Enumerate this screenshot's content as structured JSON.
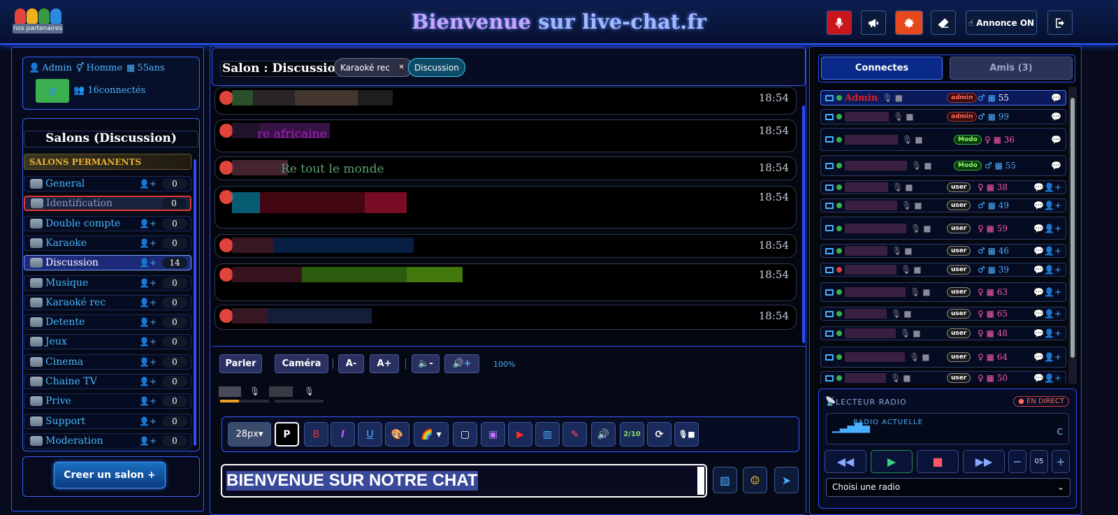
{
  "header": {
    "logo_label": "nos partenaires",
    "title_part1": "Bienvenue",
    "title_part2": " sur live-chat.fr",
    "buttons": [
      {
        "icon": "microphone-icon",
        "color": "#c8161c"
      },
      {
        "icon": "megaphone-icon",
        "color": "#0b1a3a"
      },
      {
        "icon": "gear-icon",
        "color": "#e8491c"
      },
      {
        "icon": "eraser-icon",
        "color": "#0b1a3a"
      },
      {
        "icon": "hand-icon",
        "label": "Annonce ON",
        "color": "#0b1a3a"
      },
      {
        "icon": "logout-icon",
        "color": "#0b1a3a"
      }
    ]
  },
  "user": {
    "name": "Admin",
    "gender": "Homme",
    "age": "55ans",
    "connected": "16connectés"
  },
  "salons": {
    "title": "Salons (Discussion)",
    "permanent_label": "SALONS PERMANENTS",
    "items": [
      {
        "label": "General",
        "count": "0"
      },
      {
        "label": "Identification",
        "count": "0"
      },
      {
        "label": "Double compte",
        "count": "0"
      },
      {
        "label": "Karaoke",
        "count": "0"
      },
      {
        "label": "Discussion",
        "count": "14"
      },
      {
        "label": "Musique",
        "count": "0"
      },
      {
        "label": "Karaoké rec",
        "count": "0"
      },
      {
        "label": "Detente",
        "count": "0"
      },
      {
        "label": "Jeux",
        "count": "0"
      },
      {
        "label": "Cinema",
        "count": "0"
      },
      {
        "label": "Chaine TV",
        "count": "0"
      },
      {
        "label": "Prive",
        "count": "0"
      },
      {
        "label": "Support",
        "count": "0"
      },
      {
        "label": "Moderation",
        "count": "0"
      }
    ],
    "create_button": "Creer un salon +"
  },
  "chat": {
    "salon_title": "Salon : Discussion",
    "tabs": [
      {
        "label": "Karaoké rec",
        "closable": true
      },
      {
        "label": "Discussion",
        "closable": false
      }
    ],
    "messages": [
      {
        "time": "18:54",
        "text": ""
      },
      {
        "time": "18:54",
        "text": "re africaine"
      },
      {
        "time": "18:54",
        "text": "Re tout le monde"
      },
      {
        "time": "18:54",
        "text": ""
      },
      {
        "time": "18:54",
        "text": ""
      },
      {
        "time": "18:54",
        "text": ""
      },
      {
        "time": "18:54",
        "text": ""
      }
    ]
  },
  "controls": {
    "speak": "Parler",
    "camera": "Caméra",
    "font_minus": "A-",
    "font_plus": "A+",
    "volume": "100%",
    "font_size": "28px",
    "bold_p": "P",
    "bold_b": "B",
    "italic": "I",
    "underline": "U",
    "counter": "2/10",
    "input_value": "BIENVENUE SUR NOTRE CHAT"
  },
  "right": {
    "tab_connected": "Connectes",
    "tab_friends": "Amis (3)",
    "users": [
      {
        "name": "Admin",
        "role": "admin",
        "gender": "m",
        "age": "55"
      },
      {
        "name": "",
        "role": "admin",
        "gender": "m",
        "age": "99"
      },
      {
        "name": "",
        "role": "Modo",
        "gender": "f",
        "age": "36"
      },
      {
        "name": "",
        "role": "Modo",
        "gender": "m",
        "age": "55"
      },
      {
        "name": "",
        "role": "user",
        "gender": "f",
        "age": "38"
      },
      {
        "name": "",
        "role": "user",
        "gender": "m",
        "age": "49"
      },
      {
        "name": "",
        "role": "user",
        "gender": "f",
        "age": "59"
      },
      {
        "name": "",
        "role": "user",
        "gender": "m",
        "age": "46"
      },
      {
        "name": "",
        "role": "user",
        "gender": "m",
        "age": "39"
      },
      {
        "name": "",
        "role": "user",
        "gender": "f",
        "age": "63"
      },
      {
        "name": "",
        "role": "user",
        "gender": "f",
        "age": "65"
      },
      {
        "name": "",
        "role": "user",
        "gender": "f",
        "age": "48"
      },
      {
        "name": "",
        "role": "user",
        "gender": "f",
        "age": "64"
      },
      {
        "name": "",
        "role": "user",
        "gender": "f",
        "age": "50"
      }
    ],
    "radio": {
      "title": "LECTEUR RADIO",
      "live": "● EN DIRECT",
      "current": "RADIO ACTUELLE",
      "current_short": "C",
      "volume": "05",
      "select_placeholder": "Choisi une radio"
    }
  }
}
